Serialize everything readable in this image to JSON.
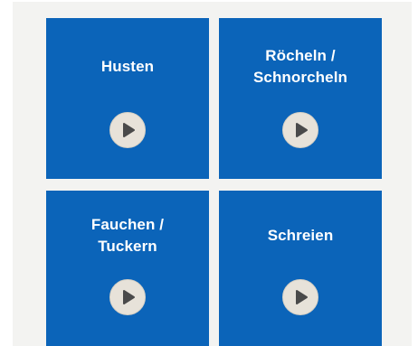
{
  "tiles": [
    {
      "label": "Husten",
      "icon": "play-icon"
    },
    {
      "label": "Röcheln /\nSchnorcheln",
      "icon": "play-icon"
    },
    {
      "label": "Fauchen /\nTuckern",
      "icon": "play-icon"
    },
    {
      "label": "Schreien",
      "icon": "play-icon"
    }
  ],
  "colors": {
    "tile_background": "#0b64b9",
    "tile_text": "#ffffff",
    "play_button_background": "#e7e2d9",
    "play_icon": "#4a4a4a",
    "panel_background": "#f3f3f1"
  }
}
